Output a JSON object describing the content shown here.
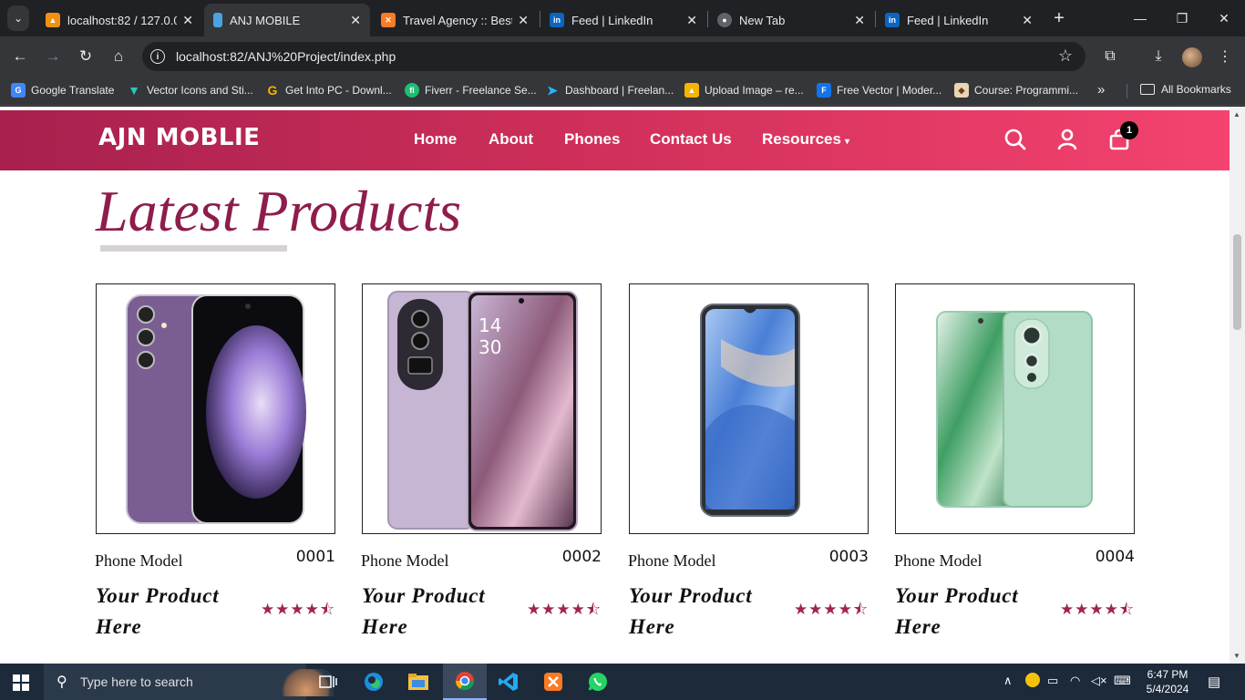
{
  "browser": {
    "tabs": [
      {
        "title": "localhost:82 / 127.0.0.",
        "icon": "phpmyadmin-icon"
      },
      {
        "title": "ANJ MOBILE",
        "icon": "page-icon"
      },
      {
        "title": "Travel Agency :: Best /",
        "icon": "xampp-icon"
      },
      {
        "title": "Feed | LinkedIn",
        "icon": "linkedin-icon"
      },
      {
        "title": "New Tab",
        "icon": "chrome-icon"
      },
      {
        "title": "Feed | LinkedIn",
        "icon": "linkedin-icon"
      }
    ],
    "url": "localhost:82/ANJ%20Project/index.php",
    "bookmarks": [
      {
        "label": "Google Translate",
        "icon": "google-translate-icon"
      },
      {
        "label": "Vector Icons and Sti...",
        "icon": "vector-icon"
      },
      {
        "label": "Get Into PC - Downl...",
        "icon": "getintopc-icon"
      },
      {
        "label": "Fiverr - Freelance Se...",
        "icon": "fiverr-icon"
      },
      {
        "label": "Dashboard | Freelan...",
        "icon": "freelancer-icon"
      },
      {
        "label": "Upload Image – re...",
        "icon": "upload-icon"
      },
      {
        "label": "Free Vector | Moder...",
        "icon": "freepik-icon"
      },
      {
        "label": "Course: Programmi...",
        "icon": "course-icon"
      }
    ],
    "all_bookmarks_label": "All Bookmarks"
  },
  "site": {
    "logo": "AJN MOBLIE",
    "nav": [
      "Home",
      "About",
      "Phones",
      "Contact Us",
      "Resources"
    ],
    "cart_count": "1",
    "brand_color": "#d1305a",
    "accent_color": "#8e1d4c"
  },
  "section": {
    "title": "Latest Products"
  },
  "products": [
    {
      "label": "Phone Model",
      "number": "0001",
      "name": "Your Product Here",
      "rating": 4.5,
      "stars": "★★★★⯪"
    },
    {
      "label": "Phone Model",
      "number": "0002",
      "name": "Your Product Here",
      "rating": 4.5,
      "stars": "★★★★⯪"
    },
    {
      "label": "Phone Model",
      "number": "0003",
      "name": "Your Product Here",
      "rating": 4.5,
      "stars": "★★★★⯪"
    },
    {
      "label": "Phone Model",
      "number": "0004",
      "name": "Your Product Here",
      "rating": 4.5,
      "stars": "★★★★⯪"
    }
  ],
  "taskbar": {
    "search_placeholder": "Type here to search",
    "time": "6:47 PM",
    "date": "5/4/2024"
  }
}
